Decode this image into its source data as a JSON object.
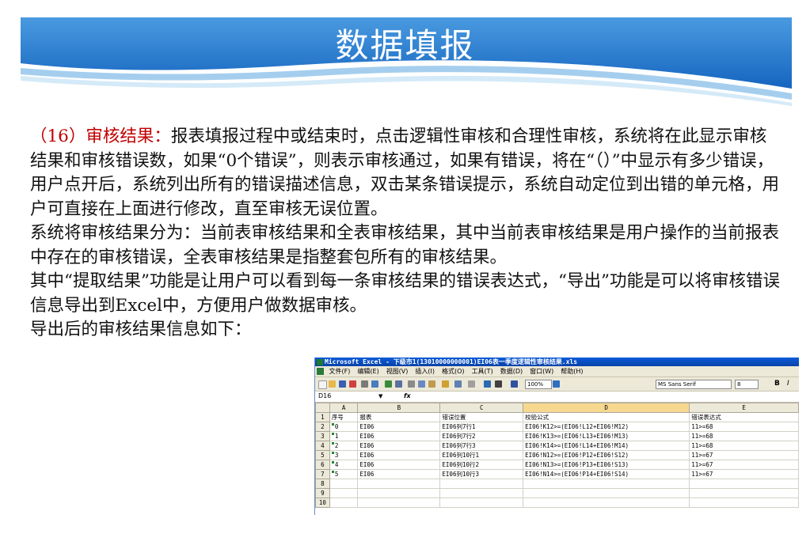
{
  "slide": {
    "title": "数据填报",
    "colors": {
      "banner_top": "#3d8ed8",
      "banner_bottom": "#1565c0",
      "highlight": "#c00000"
    }
  },
  "paragraphs": {
    "p1_label": "（16）审核结果：",
    "p1_text": "报表填报过程中或结束时，点击逻辑性审核和合理性审核，系统将在此显示审核结果和审核错误数，如果“0个错误”，则表示审核通过，如果有错误，将在“（）”中显示有多少错误，用户点开后，系统列出所有的错误描述信息，双击某条错误提示，系统自动定位到出错的单元格，用户可直接在上面进行修改，直至审核无误位置。",
    "p2": "系统将审核结果分为：当前表审核结果和全表审核结果，其中当前表审核结果是用户操作的当前报表中存在的审核错误，全表审核结果是指整套包所有的审核结果。",
    "p3": "其中“提取结果”功能是让用户可以看到每一条审核结果的错误表达式，“导出”功能是可以将审核错误信息导出到Excel中，方便用户做数据审核。",
    "p4": "导出后的审核结果信息如下："
  },
  "excel": {
    "window_title": "Microsoft Excel - 下级市1(13010000000001)EI06表一季度逻辑性审核结果.xls",
    "menu": [
      "文件(F)",
      "编辑(E)",
      "视图(V)",
      "插入(I)",
      "格式(O)",
      "工具(T)",
      "数据(D)",
      "窗口(W)",
      "帮助(H)"
    ],
    "zoom": "100%",
    "font_name": "MS Sans Serif",
    "font_size": "8",
    "bold_label": "B",
    "italic_label": "I",
    "name_box": "D16",
    "fx_label": "fx",
    "column_headers": [
      "A",
      "B",
      "C",
      "D",
      "E"
    ],
    "row_numbers": [
      "1",
      "2",
      "3",
      "4",
      "5",
      "6",
      "7",
      "8",
      "9",
      "10"
    ],
    "rows": [
      [
        "序号",
        "报表",
        "错误位置",
        "校验公式",
        "错误表达式"
      ],
      [
        "0",
        "EI06",
        "EI06列7行1",
        "EI06!K12>=(EI06!L12+EI06!M12)",
        "11>=68"
      ],
      [
        "1",
        "EI06",
        "EI06列7行2",
        "EI06!K13>=(EI06!L13+EI06!M13)",
        "11>=68"
      ],
      [
        "2",
        "EI06",
        "EI06列7行3",
        "EI06!K14>=(EI06!L14+EI06!M14)",
        "11>=68"
      ],
      [
        "3",
        "EI06",
        "EI06列10行1",
        "EI06!N12>=(EI06!P12+EI06!S12)",
        "11>=67"
      ],
      [
        "4",
        "EI06",
        "EI06列10行2",
        "EI06!N13>=(EI06!P13+EI06!S13)",
        "11>=67"
      ],
      [
        "5",
        "EI06",
        "EI06列10行3",
        "EI06!N14>=(EI06!P14+EI06!S14)",
        "11>=67"
      ],
      [
        "",
        "",
        "",
        "",
        ""
      ],
      [
        "",
        "",
        "",
        "",
        ""
      ],
      [
        "",
        "",
        "",
        "",
        ""
      ]
    ]
  }
}
